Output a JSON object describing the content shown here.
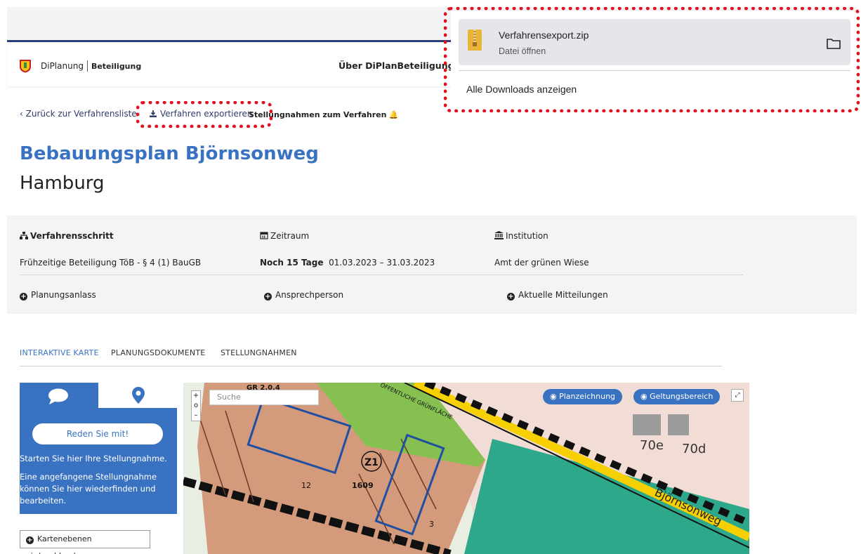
{
  "header": {
    "brand_name": "DiPlanung",
    "brand_sub": "Beteiligung",
    "nav_about": "Über DiPlanBeteiligung"
  },
  "subnav": {
    "back_label": "‹ Zurück zur Verfahrensliste",
    "export_label": "Verfahren exportieren",
    "statements_label": "Stellungnahmen zum Verfahren"
  },
  "page": {
    "title": "Bebauungsplan Björnsonweg",
    "subtitle": "Hamburg"
  },
  "info": {
    "step_label": "Verfahrensschritt",
    "step_value": "Frühzeitige Beteiligung TöB - § 4 (1) BauGB",
    "period_label": "Zeitraum",
    "period_remaining": "Noch 15 Tage",
    "period_dates": "01.03.2023 – 31.03.2023",
    "institution_label": "Institution",
    "institution_value": "Amt der grünen Wiese",
    "accordion": [
      "Planungsanlass",
      "Ansprechperson",
      "Aktuelle Mitteilungen"
    ]
  },
  "tabs": [
    "INTERAKTIVE KARTE",
    "PLANUNGSDOKUMENTE",
    "STELLUNGNAHMEN"
  ],
  "sidebar": {
    "cta_label": "Reden Sie mit!",
    "text1": "Starten Sie hier Ihre Stellungnahme.",
    "text2": "Eine angefangene Stellungnahme können Sie hier wiederfinden und bearbeiten.",
    "layers_label": "Kartenebenen ein/ausblenden"
  },
  "map": {
    "search_placeholder": "Suche",
    "zoom_in": "+",
    "zoom_reset": "o",
    "zoom_out": "–",
    "pill_planzeichnung": "Planzeichnung",
    "pill_geltungsbereich": "Geltungsbereich",
    "labels": {
      "gr": "GR 2.0,4",
      "gruen": "ÖFFENTLICHE GRÜNFLÄCHE",
      "z1": "Z1",
      "n1609": "1609",
      "n12": "12",
      "n3": "3",
      "n70e": "70e",
      "n70d": "70d",
      "street": "Björnsonweg"
    }
  },
  "downloads": {
    "file_name": "Verfahrensexport.zip",
    "file_action": "Datei öffnen",
    "show_all": "Alle Downloads anzeigen"
  },
  "colors": {
    "accent": "#3a72c2",
    "highlight": "#e01020",
    "navy": "#2a3d7a"
  }
}
